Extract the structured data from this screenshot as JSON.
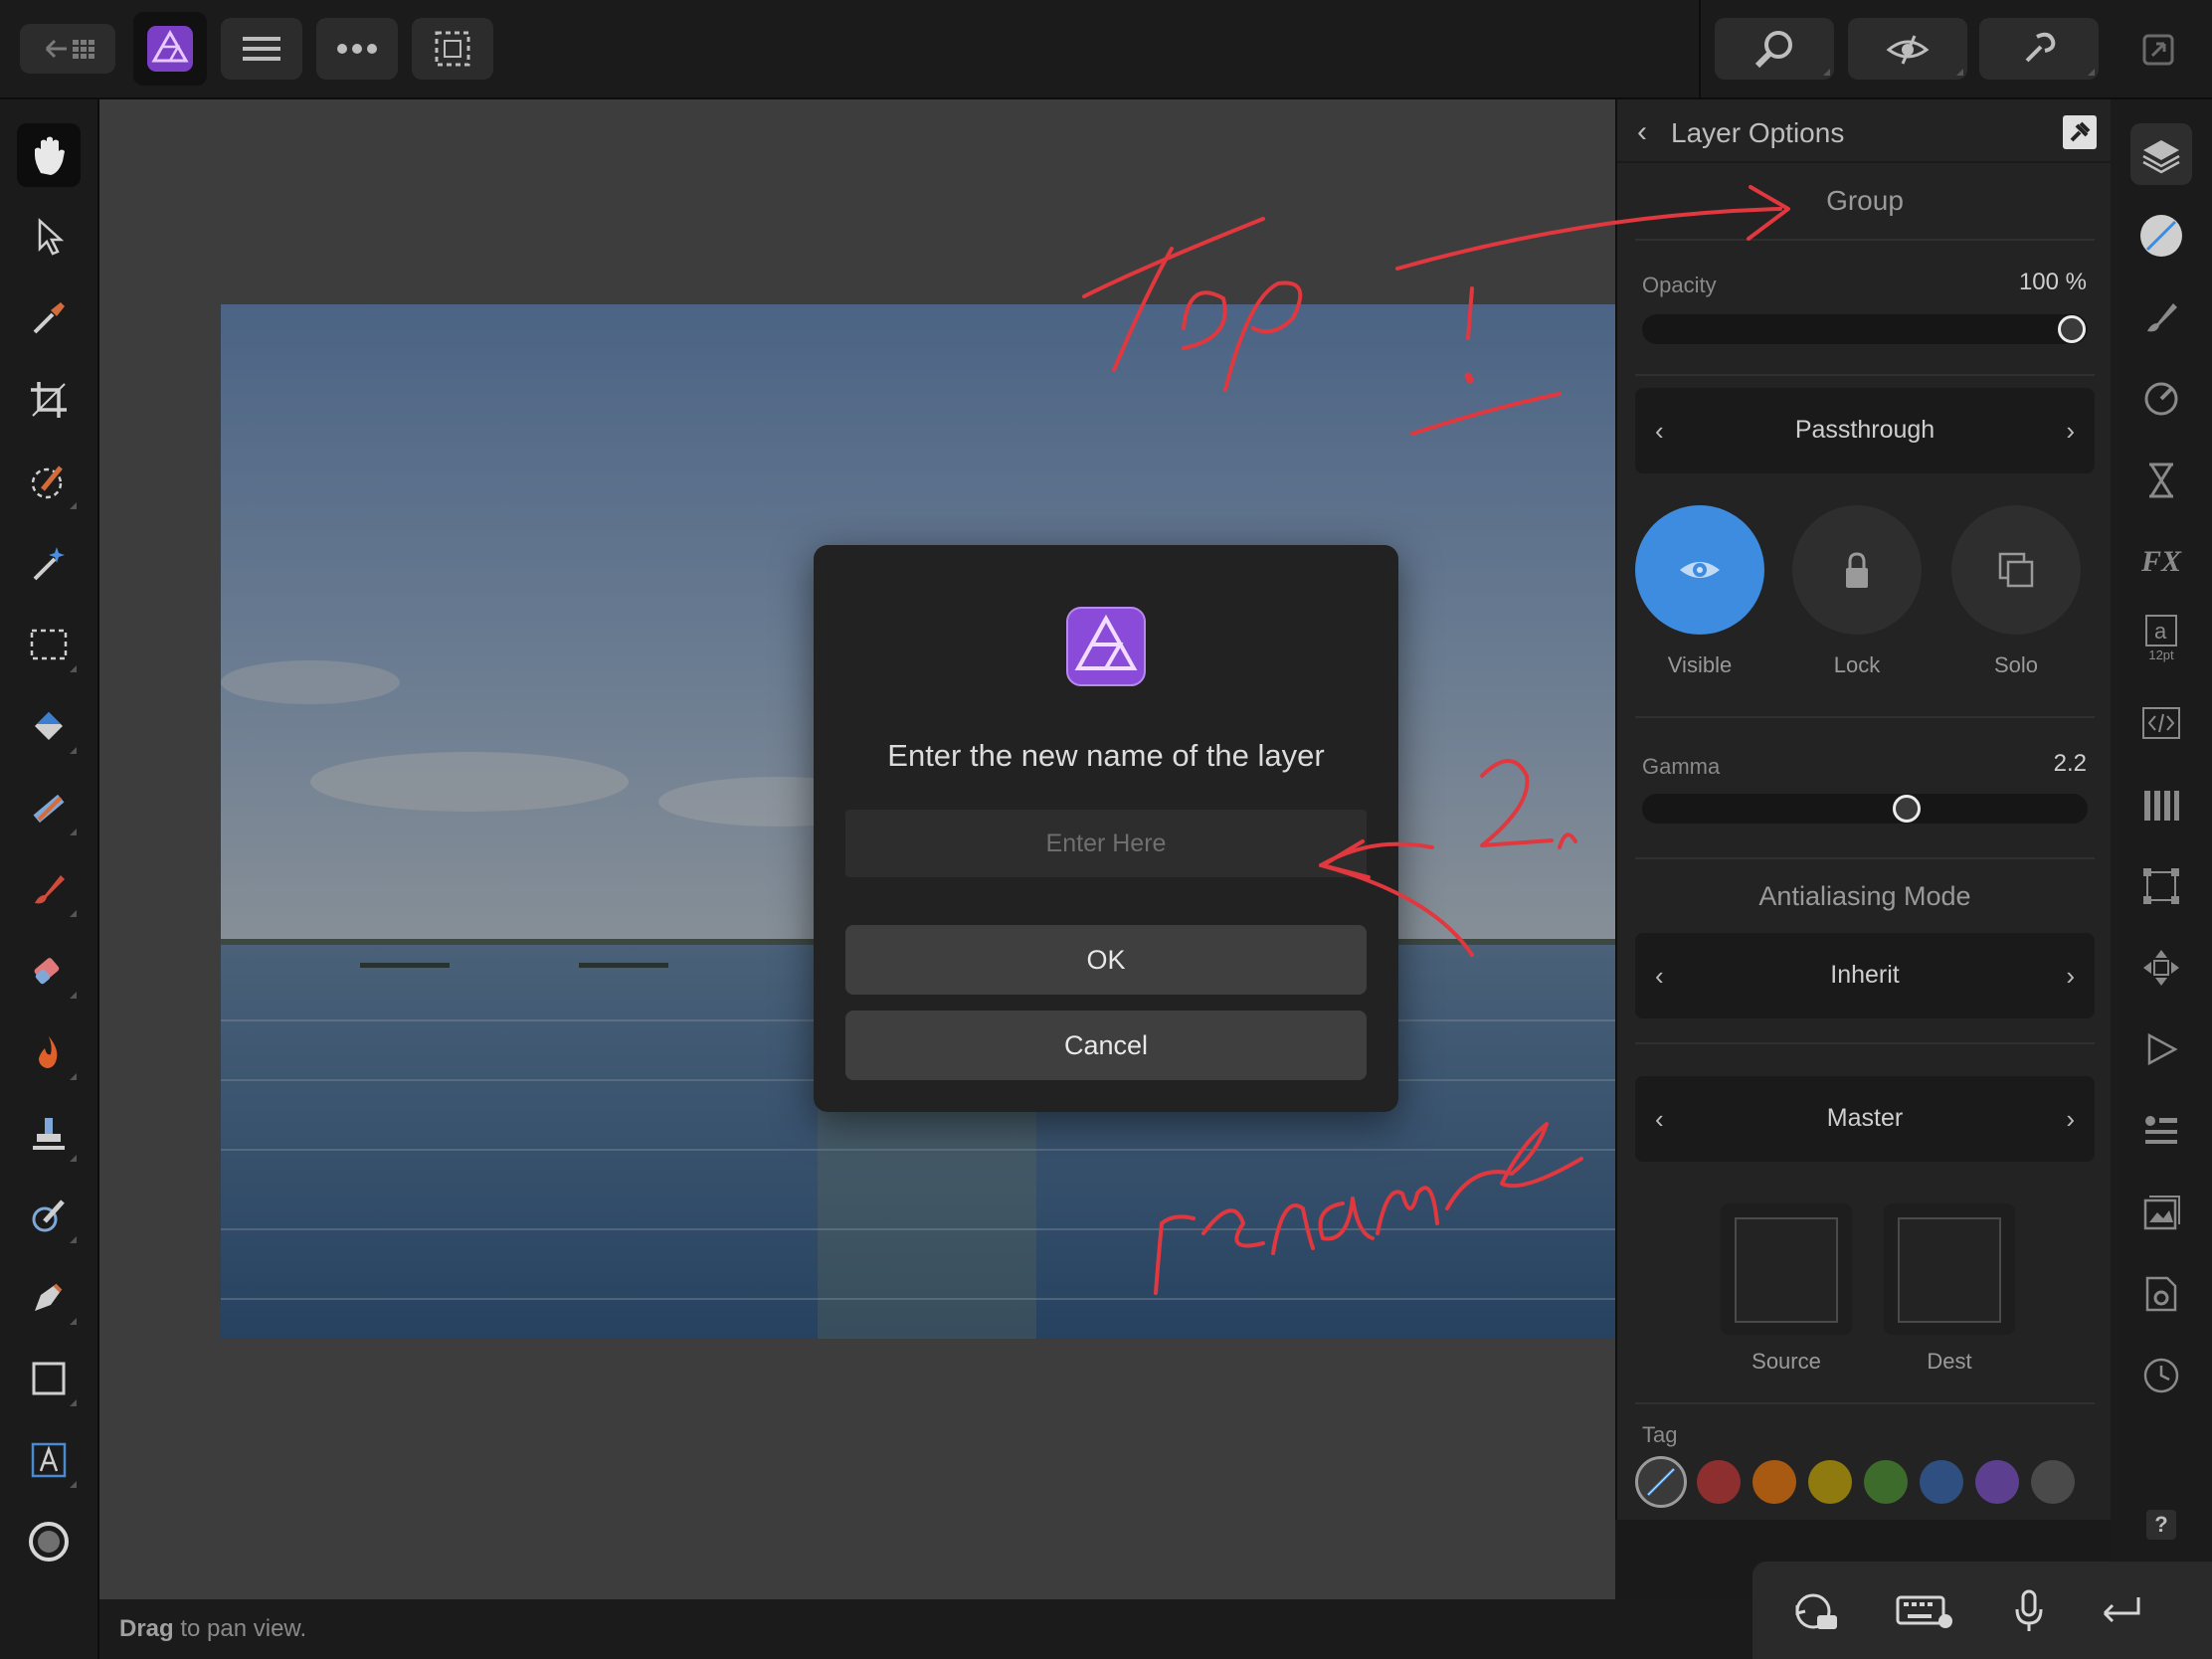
{
  "status": {
    "drag_word": "Drag",
    "rest": " to pan view."
  },
  "panel": {
    "title": "Layer Options",
    "layer_type": "Group",
    "opacity": {
      "label": "Opacity",
      "value": "100 %",
      "fraction": 1.0
    },
    "blend_mode": "Passthrough",
    "toggles": {
      "visible": "Visible",
      "lock": "Lock",
      "solo": "Solo"
    },
    "gamma": {
      "label": "Gamma",
      "value": "2.2"
    },
    "antialiasing": {
      "heading": "Antialiasing Mode",
      "value": "Inherit"
    },
    "channel": "Master",
    "source_label": "Source",
    "dest_label": "Dest",
    "tag": {
      "label": "Tag",
      "colors": [
        "#8e2f2f",
        "#a85a12",
        "#8f7a10",
        "#3d6b2c",
        "#2f4f80",
        "#5d3f8f",
        "#4a4a4a"
      ]
    }
  },
  "studio": {
    "font_size_badge": "12pt"
  },
  "dialog": {
    "title": "Enter the new name of the layer",
    "input_placeholder": "Enter Here",
    "ok": "OK",
    "cancel": "Cancel"
  },
  "colors": {
    "accent": "#3d8ce0",
    "annotation": "#e0383e",
    "panel_bg": "#232323"
  }
}
